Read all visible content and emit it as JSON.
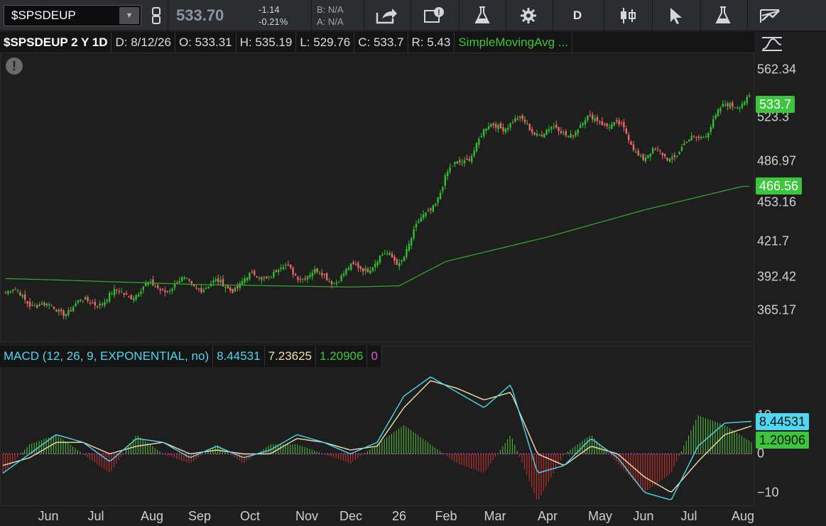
{
  "toolbar": {
    "symbol": "$SPSDEUP",
    "last_price": "533.70",
    "net_change": "-1.14",
    "pct_change": "-0.21%",
    "bid": "B: N/A",
    "ask": "A: N/A",
    "period_button": "D",
    "icons": [
      "link-icon",
      "share-icon",
      "active-trader-icon",
      "flask-icon",
      "gear-icon",
      "period-icon",
      "candle-style-icon",
      "cursor-icon",
      "studies-flask-icon",
      "drawings-icon",
      "pattern-icon"
    ]
  },
  "chart_header": {
    "title": "$SPSDEUP 2 Y 1D",
    "date": "D: 8/12/26",
    "open": "O: 533.31",
    "high": "H: 535.19",
    "low": "L: 529.76",
    "close": "C: 533.7",
    "range": "R: 5.43",
    "study": "SimpleMovingAvg ..."
  },
  "price_axis": {
    "ticks": [
      "562.34",
      "523.3",
      "486.97",
      "453.16",
      "421.7",
      "392.42",
      "365.17"
    ],
    "last_tag": "533.7",
    "sma_tag": "466.56",
    "colors": {
      "last": "#3ec53e",
      "sma": "#3ec53e"
    }
  },
  "macd_header": {
    "name": "MACD (12, 26, 9, EXPONENTIAL, no)",
    "value": "8.44531",
    "avg": "7.23625",
    "diff": "1.20906",
    "zero": "0"
  },
  "macd_axis": {
    "ticks": [
      "10",
      "0",
      "−10"
    ],
    "value_tag": "8.44531",
    "diff_tag": "1.20906"
  },
  "x_axis": {
    "labels": [
      "Jun",
      "Jul",
      "Aug",
      "Sep",
      "Oct",
      "Nov",
      "Dec",
      "26",
      "Feb",
      "Mar",
      "Apr",
      "May",
      "Jun",
      "Jul",
      "Aug"
    ]
  },
  "chart_data": [
    {
      "type": "candlestick",
      "title": "$SPSDEUP 2 Y 1D",
      "x_ticks": [
        "Jun",
        "Jul",
        "Aug",
        "Sep",
        "Oct",
        "Nov",
        "Dec",
        "26",
        "Feb",
        "Mar",
        "Apr",
        "May",
        "Jun",
        "Jul",
        "Aug"
      ],
      "y_ticks": [
        365.17,
        392.42,
        421.7,
        453.16,
        486.97,
        523.3,
        562.34
      ],
      "ylim": [
        340,
        575
      ],
      "close_path": [
        {
          "x": "Jun",
          "y": 360
        },
        {
          "x": "Jul",
          "y": 380
        },
        {
          "x": "Aug",
          "y": 376
        },
        {
          "x": "Sep",
          "y": 392
        },
        {
          "x": "Oct",
          "y": 386
        },
        {
          "x": "Nov",
          "y": 398
        },
        {
          "x": "Dec",
          "y": 398
        },
        {
          "x": "26",
          "y": 402
        },
        {
          "x": "Feb",
          "y": 480
        },
        {
          "x": "Mar",
          "y": 512
        },
        {
          "x": "Apr",
          "y": 516
        },
        {
          "x": "May",
          "y": 520
        },
        {
          "x": "Jun",
          "y": 490
        },
        {
          "x": "Jul",
          "y": 505
        },
        {
          "x": "Aug",
          "y": 533.7
        }
      ],
      "sma_path": [
        {
          "x": "Jun",
          "y": 390
        },
        {
          "x": "Sep",
          "y": 386
        },
        {
          "x": "Dec",
          "y": 384
        },
        {
          "x": "26",
          "y": 385
        },
        {
          "x": "Feb",
          "y": 405
        },
        {
          "x": "Apr",
          "y": 425
        },
        {
          "x": "Jun",
          "y": 447
        },
        {
          "x": "Aug",
          "y": 466.56
        }
      ],
      "last": 533.7,
      "sma_last": 466.56
    },
    {
      "type": "line",
      "title": "MACD (12, 26, 9, EXPONENTIAL, no)",
      "ylim": [
        -13,
        22
      ],
      "y_ticks": [
        -10,
        0,
        10
      ],
      "series": [
        {
          "name": "Value",
          "values": [
            -5,
            0,
            5,
            3,
            -2,
            4,
            3,
            -1,
            2,
            -1,
            1,
            5,
            3,
            0,
            3,
            15,
            20,
            16,
            12,
            18,
            -5,
            -3,
            4,
            -1,
            -10,
            -12,
            2,
            8,
            8.44531
          ]
        },
        {
          "name": "Avg",
          "values": [
            -3,
            -1,
            3,
            3,
            0,
            2,
            3,
            0,
            1,
            0,
            0,
            4,
            3,
            1,
            2,
            12,
            19,
            17,
            14,
            16,
            0,
            -3,
            2,
            0,
            -6,
            -10,
            -2,
            5,
            7.23625
          ]
        },
        {
          "name": "Diff",
          "values": [
            -2,
            1,
            2,
            0,
            -2,
            2,
            0,
            -1,
            1,
            -1,
            1,
            1,
            0,
            -1,
            1,
            3,
            1,
            -1,
            -2,
            2,
            -5,
            0,
            2,
            -1,
            -4,
            -2,
            4,
            3,
            1.20906
          ]
        }
      ]
    }
  ]
}
